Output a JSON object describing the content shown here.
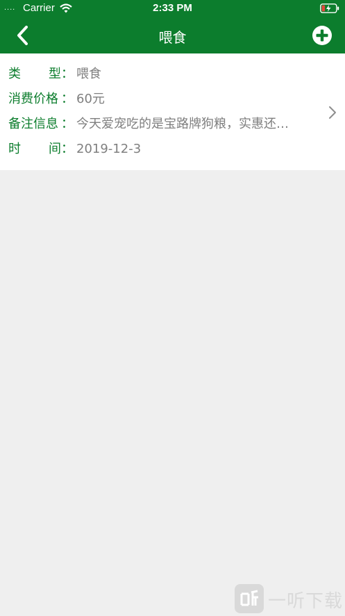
{
  "status_bar": {
    "signal": "....",
    "carrier": "Carrier",
    "time": "2:33 PM"
  },
  "nav": {
    "title": "喂食"
  },
  "record": {
    "type_label_chars": [
      "类",
      "型"
    ],
    "price_label": "消费价格",
    "note_label": "备注信息",
    "time_label_chars": [
      "时",
      "间"
    ],
    "colon": "：",
    "type_value": "喂食",
    "price_value": "60元",
    "note_value": "今天爱宠吃的是宝路牌狗粮，实惠还…",
    "time_value": "2019-12-3"
  },
  "watermark": {
    "text": "一听下载"
  },
  "colors": {
    "brand": "#0c7d2d",
    "value_text": "#7f7f7f",
    "background": "#efefef"
  },
  "icons": {
    "back": "chevron-left-icon",
    "add": "plus-circle-icon",
    "disclosure": "chevron-right-icon",
    "wifi": "wifi-icon",
    "battery": "battery-charging-icon"
  }
}
